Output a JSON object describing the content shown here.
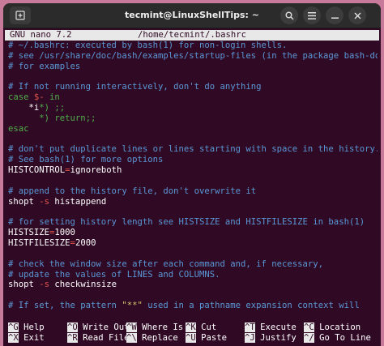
{
  "window": {
    "title": "tecmint@LinuxShellTips: ~",
    "new_tab_icon": "new-tab-icon",
    "search_icon": "search-icon",
    "menu_icon": "hamburger-menu-icon",
    "minimize_icon": "minimize-icon",
    "close_icon": "close-icon"
  },
  "nano": {
    "version": "GNU nano 7.2",
    "filename": "/home/tecmint/.bashrc"
  },
  "buffer": [
    [
      {
        "t": "# ~/.bashrc: executed by bash(1) for non-login shells.",
        "c": "cmt"
      }
    ],
    [
      {
        "t": "# see /usr/share/doc/bash/examples/startup-files (in the package bash-doc)",
        "c": "cmt"
      }
    ],
    [
      {
        "t": "# for examples",
        "c": "cmt"
      }
    ],
    [],
    [
      {
        "t": "# If not running interactively, don't do anything",
        "c": "cmt"
      }
    ],
    [
      {
        "t": "case ",
        "c": "kw"
      },
      {
        "t": "$-",
        "c": "red"
      },
      {
        "t": " in",
        "c": "kw"
      }
    ],
    [
      {
        "t": "    *",
        "c": "wht"
      },
      {
        "t": "i",
        "c": "wht"
      },
      {
        "t": "*) ;;",
        "c": "kw"
      }
    ],
    [
      {
        "t": "      *) return;;",
        "c": "kw"
      }
    ],
    [
      {
        "t": "esac",
        "c": "kw"
      }
    ],
    [],
    [
      {
        "t": "# don't put duplicate lines or lines starting with space in the history.",
        "c": "cmt"
      }
    ],
    [
      {
        "t": "# See bash(1) for more options",
        "c": "cmt"
      }
    ],
    [
      {
        "t": "HISTCONTROL",
        "c": "wht"
      },
      {
        "t": "=",
        "c": "red"
      },
      {
        "t": "ignoreboth",
        "c": "wht"
      }
    ],
    [],
    [
      {
        "t": "# append to the history file, don't overwrite it",
        "c": "cmt"
      }
    ],
    [
      {
        "t": "shopt ",
        "c": "wht"
      },
      {
        "t": "-s",
        "c": "red"
      },
      {
        "t": " histappend",
        "c": "wht"
      }
    ],
    [],
    [
      {
        "t": "# for setting history length see HISTSIZE and HISTFILESIZE in bash(1)",
        "c": "cmt"
      }
    ],
    [
      {
        "t": "HISTSIZE",
        "c": "wht"
      },
      {
        "t": "=",
        "c": "red"
      },
      {
        "t": "1000",
        "c": "wht"
      }
    ],
    [
      {
        "t": "HISTFILESIZE",
        "c": "wht"
      },
      {
        "t": "=",
        "c": "red"
      },
      {
        "t": "2000",
        "c": "wht"
      }
    ],
    [],
    [
      {
        "t": "# check the window size after each command and, if necessary,",
        "c": "cmt"
      }
    ],
    [
      {
        "t": "# update the values of LINES and COLUMNS.",
        "c": "cmt"
      }
    ],
    [
      {
        "t": "shopt ",
        "c": "wht"
      },
      {
        "t": "-s",
        "c": "red"
      },
      {
        "t": " checkwinsize",
        "c": "wht"
      }
    ],
    [],
    [
      {
        "t": "# If set, the pattern ",
        "c": "cmt"
      },
      {
        "t": "\"**\"",
        "c": "yel"
      },
      {
        "t": " used in a pathname expansion context will",
        "c": "cmt"
      }
    ]
  ],
  "shortcuts": [
    [
      {
        "key": "^G",
        "label": "Help"
      },
      {
        "key": "^O",
        "label": "Write Out"
      },
      {
        "key": "^W",
        "label": "Where Is"
      },
      {
        "key": "^K",
        "label": "Cut"
      },
      {
        "key": "^T",
        "label": "Execute"
      },
      {
        "key": "^C",
        "label": "Location"
      }
    ],
    [
      {
        "key": "^X",
        "label": "Exit"
      },
      {
        "key": "^R",
        "label": "Read File"
      },
      {
        "key": "^\\",
        "label": "Replace"
      },
      {
        "key": "^U",
        "label": "Paste"
      },
      {
        "key": "^J",
        "label": "Justify"
      },
      {
        "key": "^/",
        "label": "Go To Line"
      }
    ]
  ]
}
